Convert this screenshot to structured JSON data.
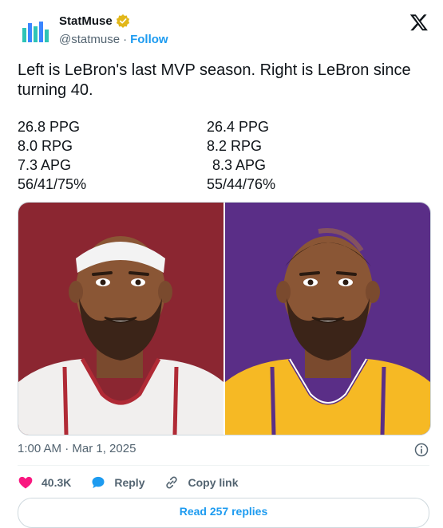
{
  "author": {
    "name": "StatMuse",
    "handle": "@statmuse",
    "separator": "·",
    "follow_label": "Follow"
  },
  "tweet": {
    "text": "Left is LeBron's last MVP season. Right is LeBron since turning 40.",
    "stats": [
      {
        "left": "26.8 PPG",
        "right": "26.4 PPG"
      },
      {
        "left": "8.0 RPG",
        "right": "8.2 RPG"
      },
      {
        "left": "7.3 APG",
        "right": "8.3 APG"
      },
      {
        "left": "56/41/75%",
        "right": "55/44/76%"
      }
    ]
  },
  "media": {
    "left_background": "#8b2631",
    "right_background": "#5a2e87",
    "left_jersey": "#f1efee",
    "right_jersey": "#f6b924"
  },
  "meta": {
    "timestamp": "1:00 AM · Mar 1, 2025"
  },
  "actions": {
    "likes": "40.3K",
    "reply_label": "Reply",
    "copy_label": "Copy link"
  },
  "read_replies_label": "Read 257 replies",
  "colors": {
    "accent": "#1d9bf0",
    "like": "#f91880",
    "verified": "#e2b719",
    "secondary_text": "#536471"
  },
  "icons": [
    "statmuse-logo-icon",
    "verified-badge-icon",
    "x-logo-icon",
    "info-icon",
    "heart-icon",
    "reply-bubble-icon",
    "link-icon"
  ]
}
